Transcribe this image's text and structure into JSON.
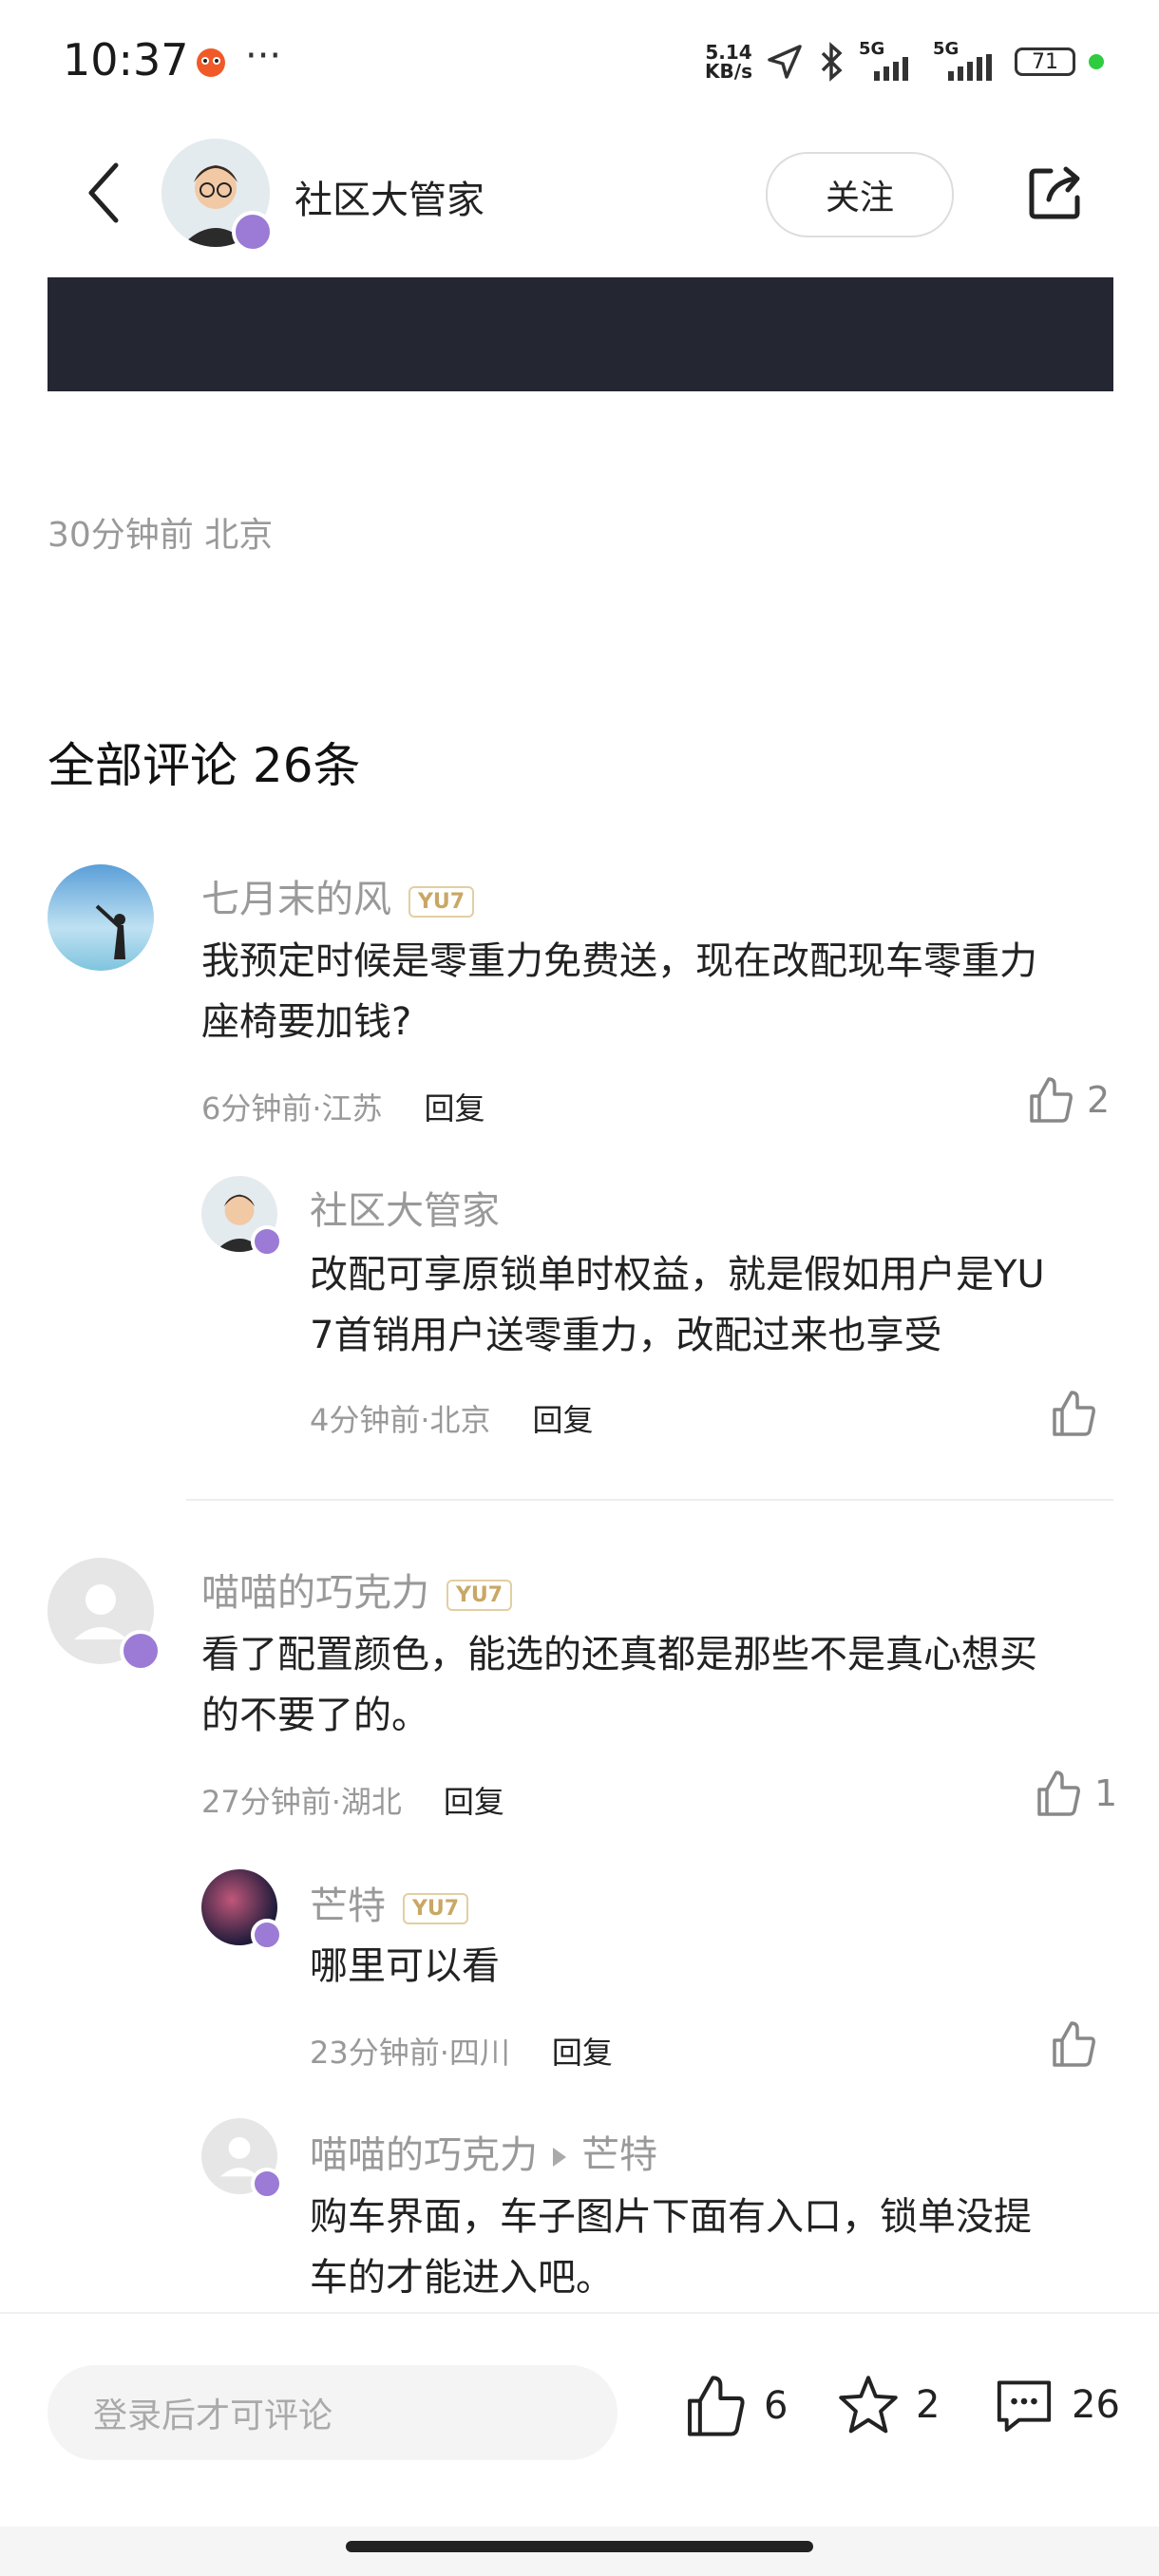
{
  "status_bar": {
    "time": "10:37",
    "more": "···",
    "net_speed_value": "5.14",
    "net_speed_unit": "KB/s",
    "signal1": "5G",
    "signal2": "5G",
    "battery": "71"
  },
  "header": {
    "name": "社区大管家",
    "follow_label": "关注"
  },
  "post": {
    "meta": "30分钟前 北京"
  },
  "comments_section": {
    "title": "全部评论 26条"
  },
  "comments": [
    {
      "user": "七月末的风",
      "tag": "YU7",
      "text_line1": "我预定时候是零重力免费送，现在改配现车零重力",
      "text_line2": "座椅要加钱?",
      "meta": "6分钟前·江苏",
      "reply_label": "回复",
      "likes": "2",
      "sub_user": "社区大管家",
      "sub_text_line1": "改配可享原锁单时权益，就是假如用户是YU",
      "sub_text_line2": "7首销用户送零重力，改配过来也享受",
      "sub_meta": "4分钟前·北京",
      "sub_reply_label": "回复"
    },
    {
      "user": "喵喵的巧克力",
      "tag": "YU7",
      "text_line1": "看了配置颜色，能选的还真都是那些不是真心想买",
      "text_line2": "的不要了的。",
      "meta": "27分钟前·湖北",
      "reply_label": "回复",
      "likes": "1",
      "sub1_user": "芒特",
      "sub1_tag": "YU7",
      "sub1_text": "哪里可以看",
      "sub1_meta": "23分钟前·四川",
      "sub1_reply_label": "回复",
      "sub2_user": "喵喵的巧克力",
      "sub2_target": "芒特",
      "sub2_text_line1": "购车界面，车子图片下面有入口，锁单没提",
      "sub2_text_line2": "车的才能进入吧。"
    }
  ],
  "bottom_bar": {
    "input_placeholder": "登录后才可评论",
    "like_count": "6",
    "star_count": "2",
    "comment_count": "26"
  },
  "colors": {
    "accent_tag": "#c9a765",
    "dark_band": "#242632",
    "muted_text": "#999999"
  }
}
